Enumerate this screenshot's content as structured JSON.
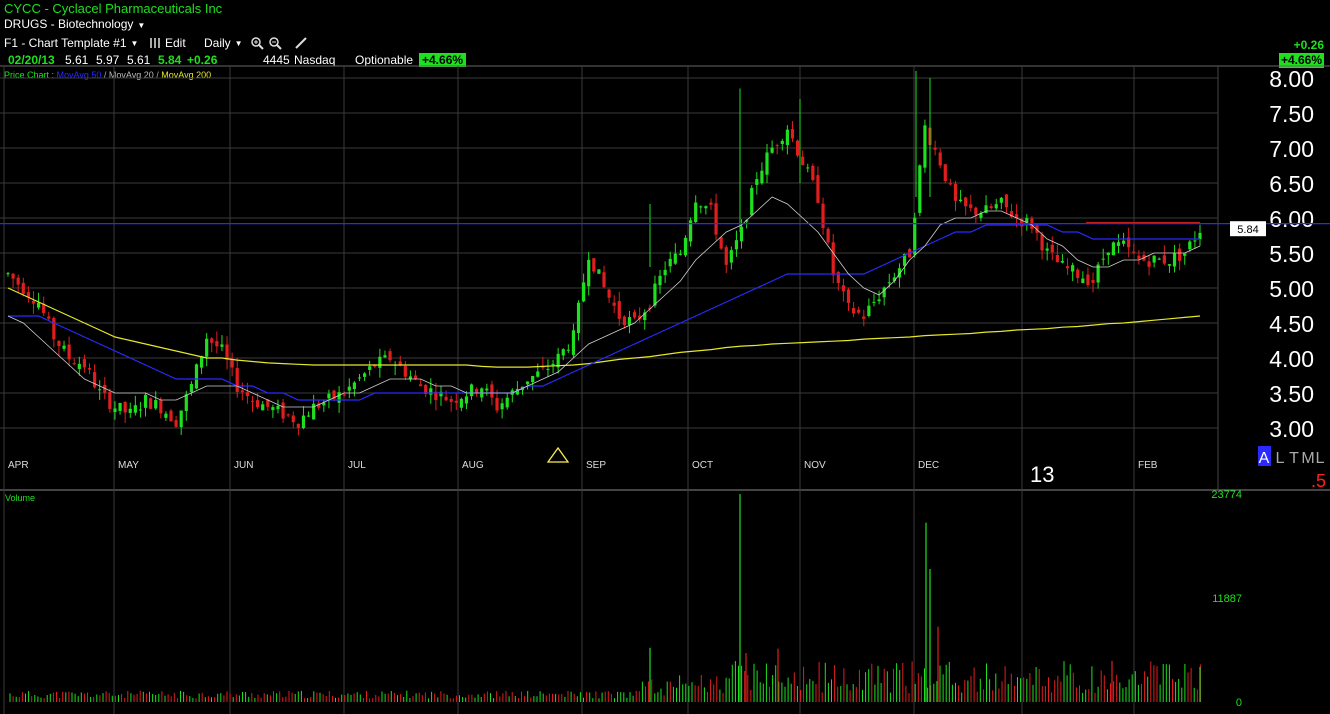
{
  "header": {
    "title": "CYCC - Cyclacel Pharmaceuticals Inc",
    "sector": "DRUGS - Biotechnology"
  },
  "toolbar": {
    "template": "F1 - Chart Template #1",
    "edit": "Edit",
    "period": "Daily"
  },
  "quote": {
    "date": "02/20/13",
    "open": "5.61",
    "high": "5.97",
    "low": "5.61",
    "last": "5.84",
    "change": "+0.26",
    "volume": "4445",
    "exchange": "Nasdaq",
    "optionable": "Optionable",
    "pct": "+4.66%"
  },
  "change_box": {
    "change": "+0.26",
    "pct": "+4.66%"
  },
  "legend": {
    "price": "Price Chart",
    "sep": " : ",
    "ma50": "MovAvg 50",
    "ma20": "MovAvg 20",
    "ma200": "MovAvg 200"
  },
  "colors": {
    "up": "#1ee01e",
    "down": "#e01e1e",
    "ma50": "#2a2aff",
    "ma20": "#d0d0d0",
    "ma200": "#e6e62a",
    "grid": "#3a3a3a",
    "hline": "#2a2aff"
  },
  "axis_modes": {
    "a": "A",
    "l": "L",
    "t": "T",
    "m": "M",
    "l2": "L"
  },
  "year_label": "13",
  "corner_value": ".5",
  "last_price_label": "5.84",
  "volume_label": "Volume",
  "chart_data": [
    {
      "type": "candlestick",
      "y_ticks": [
        3.0,
        3.5,
        4.0,
        4.5,
        5.0,
        5.5,
        6.0,
        6.5,
        7.0,
        7.5,
        8.0
      ],
      "ylim": [
        2.75,
        8.1
      ],
      "months": [
        "APR",
        "MAY",
        "JUN",
        "JUL",
        "AUG",
        "SEP",
        "OCT",
        "NOV",
        "DEC",
        "FEB"
      ],
      "reference_line": 5.92,
      "last_price": 5.84,
      "closes_approx": [
        5.2,
        5.0,
        4.8,
        4.3,
        4.0,
        3.9,
        3.5,
        3.3,
        3.2,
        3.4,
        3.3,
        3.1,
        3.6,
        4.3,
        4.1,
        3.6,
        3.4,
        3.3,
        3.2,
        3.1,
        3.3,
        3.4,
        3.5,
        3.7,
        3.9,
        4.0,
        3.8,
        3.6,
        3.5,
        3.4,
        3.5,
        3.6,
        3.3,
        3.5,
        3.7,
        3.8,
        4.0,
        4.3,
        5.5,
        5.0,
        4.6,
        4.5,
        4.8,
        5.3,
        5.5,
        6.3,
        6.1,
        5.3,
        5.8,
        6.6,
        7.0,
        7.3,
        6.8,
        6.3,
        5.2,
        4.7,
        4.6,
        4.9,
        5.2,
        5.5,
        7.3,
        6.8,
        6.2,
        6.1,
        6.1,
        6.2,
        6.0,
        5.9,
        5.5,
        5.3,
        5.2,
        5.1,
        5.6,
        5.6,
        5.4,
        5.4,
        5.4,
        5.5,
        5.84
      ],
      "ma20_approx": [
        4.6,
        4.5,
        4.3,
        4.1,
        3.9,
        3.7,
        3.6,
        3.5,
        3.5,
        3.5,
        3.4,
        3.4,
        3.5,
        3.6,
        3.6,
        3.6,
        3.5,
        3.4,
        3.3,
        3.3,
        3.3,
        3.4,
        3.5,
        3.5,
        3.6,
        3.7,
        3.7,
        3.7,
        3.6,
        3.6,
        3.5,
        3.5,
        3.5,
        3.5,
        3.6,
        3.7,
        3.8,
        4.0,
        4.2,
        4.3,
        4.4,
        4.5,
        4.7,
        4.9,
        5.1,
        5.4,
        5.6,
        5.8,
        5.9,
        6.1,
        6.3,
        6.2,
        6.0,
        5.8,
        5.5,
        5.2,
        5.0,
        4.9,
        5.1,
        5.4,
        5.6,
        5.9,
        6.0,
        6.0,
        6.1,
        6.1,
        6.0,
        5.9,
        5.7,
        5.6,
        5.4,
        5.3,
        5.3,
        5.4,
        5.4,
        5.5,
        5.5,
        5.5,
        5.6
      ],
      "ma50_approx": [
        4.6,
        4.6,
        4.6,
        4.5,
        4.4,
        4.3,
        4.2,
        4.1,
        4.0,
        3.9,
        3.8,
        3.7,
        3.7,
        3.7,
        3.7,
        3.6,
        3.6,
        3.5,
        3.5,
        3.4,
        3.4,
        3.4,
        3.4,
        3.4,
        3.5,
        3.5,
        3.5,
        3.5,
        3.5,
        3.5,
        3.5,
        3.5,
        3.5,
        3.5,
        3.6,
        3.6,
        3.7,
        3.8,
        3.9,
        4.0,
        4.1,
        4.2,
        4.3,
        4.4,
        4.5,
        4.6,
        4.7,
        4.8,
        4.9,
        5.0,
        5.1,
        5.2,
        5.2,
        5.2,
        5.2,
        5.2,
        5.2,
        5.3,
        5.4,
        5.5,
        5.6,
        5.7,
        5.8,
        5.8,
        5.9,
        5.9,
        5.9,
        5.9,
        5.9,
        5.8,
        5.8,
        5.7,
        5.7,
        5.7,
        5.7,
        5.7,
        5.7,
        5.7,
        5.7
      ],
      "ma200_approx": [
        5.0,
        4.9,
        4.8,
        4.7,
        4.6,
        4.5,
        4.4,
        4.3,
        4.25,
        4.2,
        4.15,
        4.1,
        4.05,
        4.0,
        4.0,
        3.97,
        3.95,
        3.93,
        3.92,
        3.91,
        3.9,
        3.9,
        3.9,
        3.9,
        3.9,
        3.9,
        3.9,
        3.9,
        3.9,
        3.9,
        3.9,
        3.88,
        3.87,
        3.87,
        3.87,
        3.88,
        3.89,
        3.9,
        3.92,
        3.95,
        3.98,
        4.0,
        4.02,
        4.05,
        4.08,
        4.1,
        4.12,
        4.15,
        4.17,
        4.18,
        4.2,
        4.21,
        4.22,
        4.23,
        4.24,
        4.25,
        4.27,
        4.28,
        4.29,
        4.3,
        4.32,
        4.33,
        4.34,
        4.35,
        4.37,
        4.38,
        4.4,
        4.41,
        4.42,
        4.44,
        4.45,
        4.47,
        4.49,
        4.5,
        4.52,
        4.54,
        4.56,
        4.58,
        4.6
      ]
    },
    {
      "type": "bar",
      "title": "Volume",
      "y_ticks": [
        0,
        11887,
        23774
      ],
      "ylim": [
        0,
        23774
      ]
    }
  ]
}
